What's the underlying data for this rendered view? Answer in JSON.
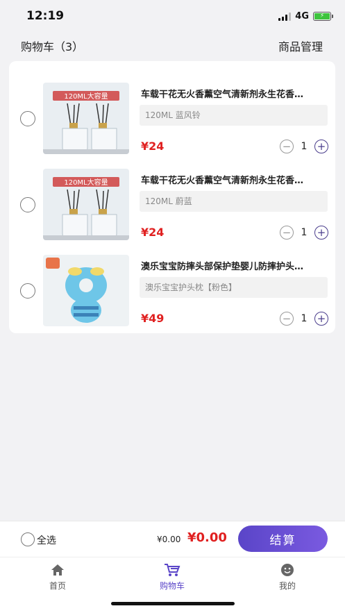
{
  "status": {
    "time": "12:19",
    "network": "4G"
  },
  "header": {
    "title": "购物车（3）",
    "manage_label": "商品管理"
  },
  "cart": {
    "items": [
      {
        "name": "车载干花无火香薰空气清新剂永生花香…",
        "spec": "120ML  蓝风铃",
        "price": "¥24",
        "qty": "1",
        "image_text": "120ML大容量",
        "image_icon": "diffuser-bottles"
      },
      {
        "name": "车载干花无火香薰空气清新剂永生花香…",
        "spec": "120ML  蔚蓝",
        "price": "¥24",
        "qty": "1",
        "image_text": "120ML大容量",
        "image_icon": "diffuser-bottles"
      },
      {
        "name": "澳乐宝宝防摔头部保护垫婴儿防摔护头…",
        "spec": "澳乐宝宝护头枕【粉色】",
        "price": "¥49",
        "qty": "1",
        "image_icon": "bee-pillow"
      }
    ]
  },
  "checkout": {
    "select_all_label": "全选",
    "subtotal": "¥0.00",
    "total": "¥0.00",
    "pay_label": "结算"
  },
  "tabs": [
    {
      "label": "首页",
      "icon": "home-icon"
    },
    {
      "label": "购物车",
      "icon": "cart-icon"
    },
    {
      "label": "我的",
      "icon": "profile-icon"
    }
  ],
  "colors": {
    "accent": "#5a45c8",
    "price": "#e02020"
  }
}
